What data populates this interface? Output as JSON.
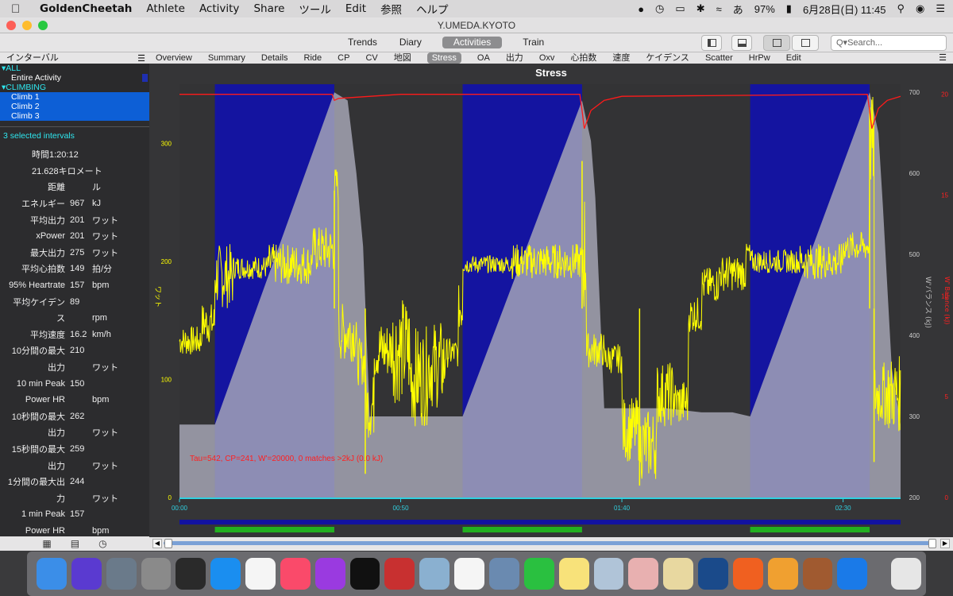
{
  "menubar": {
    "app_name": "GoldenCheetah",
    "items": [
      "Athlete",
      "Activity",
      "Share",
      "ツール",
      "Edit",
      "参照",
      "ヘルプ"
    ],
    "battery": "97%",
    "datetime": "6月28日(日)  11:45"
  },
  "window": {
    "title": "Y.UMEDA.KYOTO"
  },
  "toolbar": {
    "views": [
      "Trends",
      "Diary",
      "Activities",
      "Train"
    ],
    "active_view": "Activities",
    "search_placeholder": "Q▾Search..."
  },
  "sidebar": {
    "header": "インターバル",
    "tree": {
      "group_all": "ALL",
      "entire": "Entire Activity",
      "group_climbing": "CLIMBING",
      "climbs": [
        "Climb 1",
        "Climb 2",
        "Climb 3"
      ]
    },
    "selected_count": "3 selected intervals",
    "metrics": [
      {
        "label": "",
        "value": "時間1:20:12",
        "unit": ""
      },
      {
        "label": "",
        "value": "21.628キロメート",
        "unit": ""
      },
      {
        "label": "距離",
        "value": "",
        "unit": "ル"
      },
      {
        "label": "エネルギー",
        "value": "967",
        "unit": "kJ"
      },
      {
        "label": "平均出力",
        "value": "201",
        "unit": "ワット"
      },
      {
        "label": "xPower",
        "value": "201",
        "unit": "ワット"
      },
      {
        "label": "最大出力",
        "value": "275",
        "unit": "ワット"
      },
      {
        "label": "平均心拍数",
        "value": "149",
        "unit": "拍/分"
      },
      {
        "label": "95% Heartrate",
        "value": "157",
        "unit": "bpm"
      },
      {
        "label": "平均ケイデン",
        "value": "89",
        "unit": ""
      },
      {
        "label": "ス",
        "value": "",
        "unit": "rpm"
      },
      {
        "label": "平均速度",
        "value": "16.2",
        "unit": "km/h"
      },
      {
        "label": "10分間の最大",
        "value": "210",
        "unit": ""
      },
      {
        "label": "出力",
        "value": "",
        "unit": "ワット"
      },
      {
        "label": "10 min Peak",
        "value": "150",
        "unit": ""
      },
      {
        "label": "Power HR",
        "value": "",
        "unit": "bpm"
      },
      {
        "label": "10秒間の最大",
        "value": "262",
        "unit": ""
      },
      {
        "label": "出力",
        "value": "",
        "unit": "ワット"
      },
      {
        "label": "15秒間の最大",
        "value": "259",
        "unit": ""
      },
      {
        "label": "出力",
        "value": "",
        "unit": "ワット"
      },
      {
        "label": "1分間の最大出",
        "value": "244",
        "unit": ""
      },
      {
        "label": "力",
        "value": "",
        "unit": "ワット"
      },
      {
        "label": "1 min Peak",
        "value": "157",
        "unit": ""
      },
      {
        "label": "Power HR",
        "value": "",
        "unit": "bpm"
      }
    ]
  },
  "subtabs": {
    "items": [
      "Overview",
      "Summary",
      "Details",
      "Ride",
      "CP",
      "CV",
      "地図",
      "Stress",
      "OA",
      "出力",
      "Oxv",
      "心拍数",
      "速度",
      "ケイデンス",
      "Scatter",
      "HrPw",
      "Edit"
    ],
    "active": "Stress"
  },
  "chart_data": {
    "type": "area",
    "title": "Stress",
    "annotation": "Tau=542, CP=241, W'=20000, 0 matches >2kJ (0.0 kJ)",
    "x_ticks": [
      "00:00",
      "00:50",
      "01:40",
      "02:30"
    ],
    "x_range_min": [
      0,
      163
    ],
    "y_left": {
      "label": "ワット",
      "ticks": [
        0,
        100,
        200,
        300
      ],
      "range": [
        0,
        350
      ]
    },
    "y_right_inner": {
      "label": "W'バランス (kJ)",
      "ticks": [
        200,
        300,
        400,
        500,
        600,
        700
      ],
      "range": [
        200,
        710
      ]
    },
    "y_right_outer": {
      "label": "W' Balance (kJ)",
      "ticks": [
        0,
        5,
        10,
        15,
        20
      ],
      "range": [
        0,
        20.5
      ]
    },
    "climb_intervals_min": [
      [
        8,
        35
      ],
      [
        64,
        91
      ],
      [
        129,
        156
      ]
    ],
    "series": [
      {
        "name": "power",
        "color": "#ffff00"
      },
      {
        "name": "stress",
        "color": "#a8a8b8"
      },
      {
        "name": "W' balance",
        "color": "#ff1a1a"
      }
    ],
    "stress_points": [
      [
        0,
        290
      ],
      [
        8,
        290
      ],
      [
        35,
        700
      ],
      [
        38,
        690
      ],
      [
        40,
        600
      ],
      [
        41.5,
        510
      ],
      [
        43,
        300
      ],
      [
        56,
        300
      ],
      [
        64,
        300
      ],
      [
        91,
        690
      ],
      [
        93,
        640
      ],
      [
        94,
        570
      ],
      [
        96,
        310
      ],
      [
        110,
        310
      ],
      [
        118,
        305
      ],
      [
        125,
        305
      ],
      [
        129,
        300
      ],
      [
        156,
        700
      ],
      [
        158,
        650
      ],
      [
        159,
        560
      ],
      [
        161,
        360
      ],
      [
        163,
        290
      ]
    ],
    "wbal_points": [
      [
        0,
        20
      ],
      [
        34.5,
        20
      ],
      [
        35,
        19.7
      ],
      [
        36,
        19.8
      ],
      [
        50,
        20
      ],
      [
        90.5,
        20
      ],
      [
        91,
        19.2
      ],
      [
        91.5,
        18.3
      ],
      [
        93,
        19.2
      ],
      [
        96,
        19.7
      ],
      [
        100,
        19.9
      ],
      [
        155.5,
        20
      ],
      [
        156,
        19.2
      ],
      [
        156.5,
        18.3
      ],
      [
        158,
        19.3
      ],
      [
        160,
        19.7
      ],
      [
        163,
        19.9
      ]
    ],
    "power_segments": [
      [
        0,
        120,
        145
      ],
      [
        5,
        130,
        165
      ],
      [
        8,
        160,
        215
      ],
      [
        12,
        185,
        205
      ],
      [
        20,
        180,
        215
      ],
      [
        30,
        190,
        230
      ],
      [
        35,
        250,
        280
      ],
      [
        36,
        115,
        165
      ],
      [
        40,
        95,
        135
      ],
      [
        42,
        50,
        105
      ],
      [
        44,
        100,
        150
      ],
      [
        48,
        80,
        170
      ],
      [
        52,
        60,
        145
      ],
      [
        56,
        75,
        150
      ],
      [
        60,
        110,
        135
      ],
      [
        63,
        140,
        180
      ],
      [
        64,
        190,
        205
      ],
      [
        75,
        185,
        215
      ],
      [
        91,
        150,
        265
      ],
      [
        92,
        110,
        140
      ],
      [
        96,
        105,
        130
      ],
      [
        100,
        30,
        85
      ],
      [
        104,
        15,
        75
      ],
      [
        108,
        60,
        115
      ],
      [
        112,
        60,
        100
      ],
      [
        115,
        140,
        170
      ],
      [
        118,
        165,
        195
      ],
      [
        122,
        175,
        205
      ],
      [
        128,
        200,
        215
      ],
      [
        129,
        190,
        210
      ],
      [
        140,
        185,
        215
      ],
      [
        150,
        200,
        225
      ],
      [
        156,
        260,
        340
      ],
      [
        157,
        60,
        115
      ],
      [
        160,
        55,
        120
      ],
      [
        163,
        50,
        70
      ]
    ],
    "power_spikes": [
      [
        35,
        260
      ],
      [
        42,
        20
      ],
      [
        91,
        285
      ],
      [
        104,
        10
      ],
      [
        156,
        330
      ],
      [
        157,
        30
      ]
    ]
  },
  "colors": {
    "interval_fill": "#1414a0",
    "stress_fill": "#a8a8b8",
    "power": "#ffff00",
    "wbal": "#ff1a1a",
    "axis_left": "#ffff00",
    "axis_right_outer": "#ff2020"
  }
}
